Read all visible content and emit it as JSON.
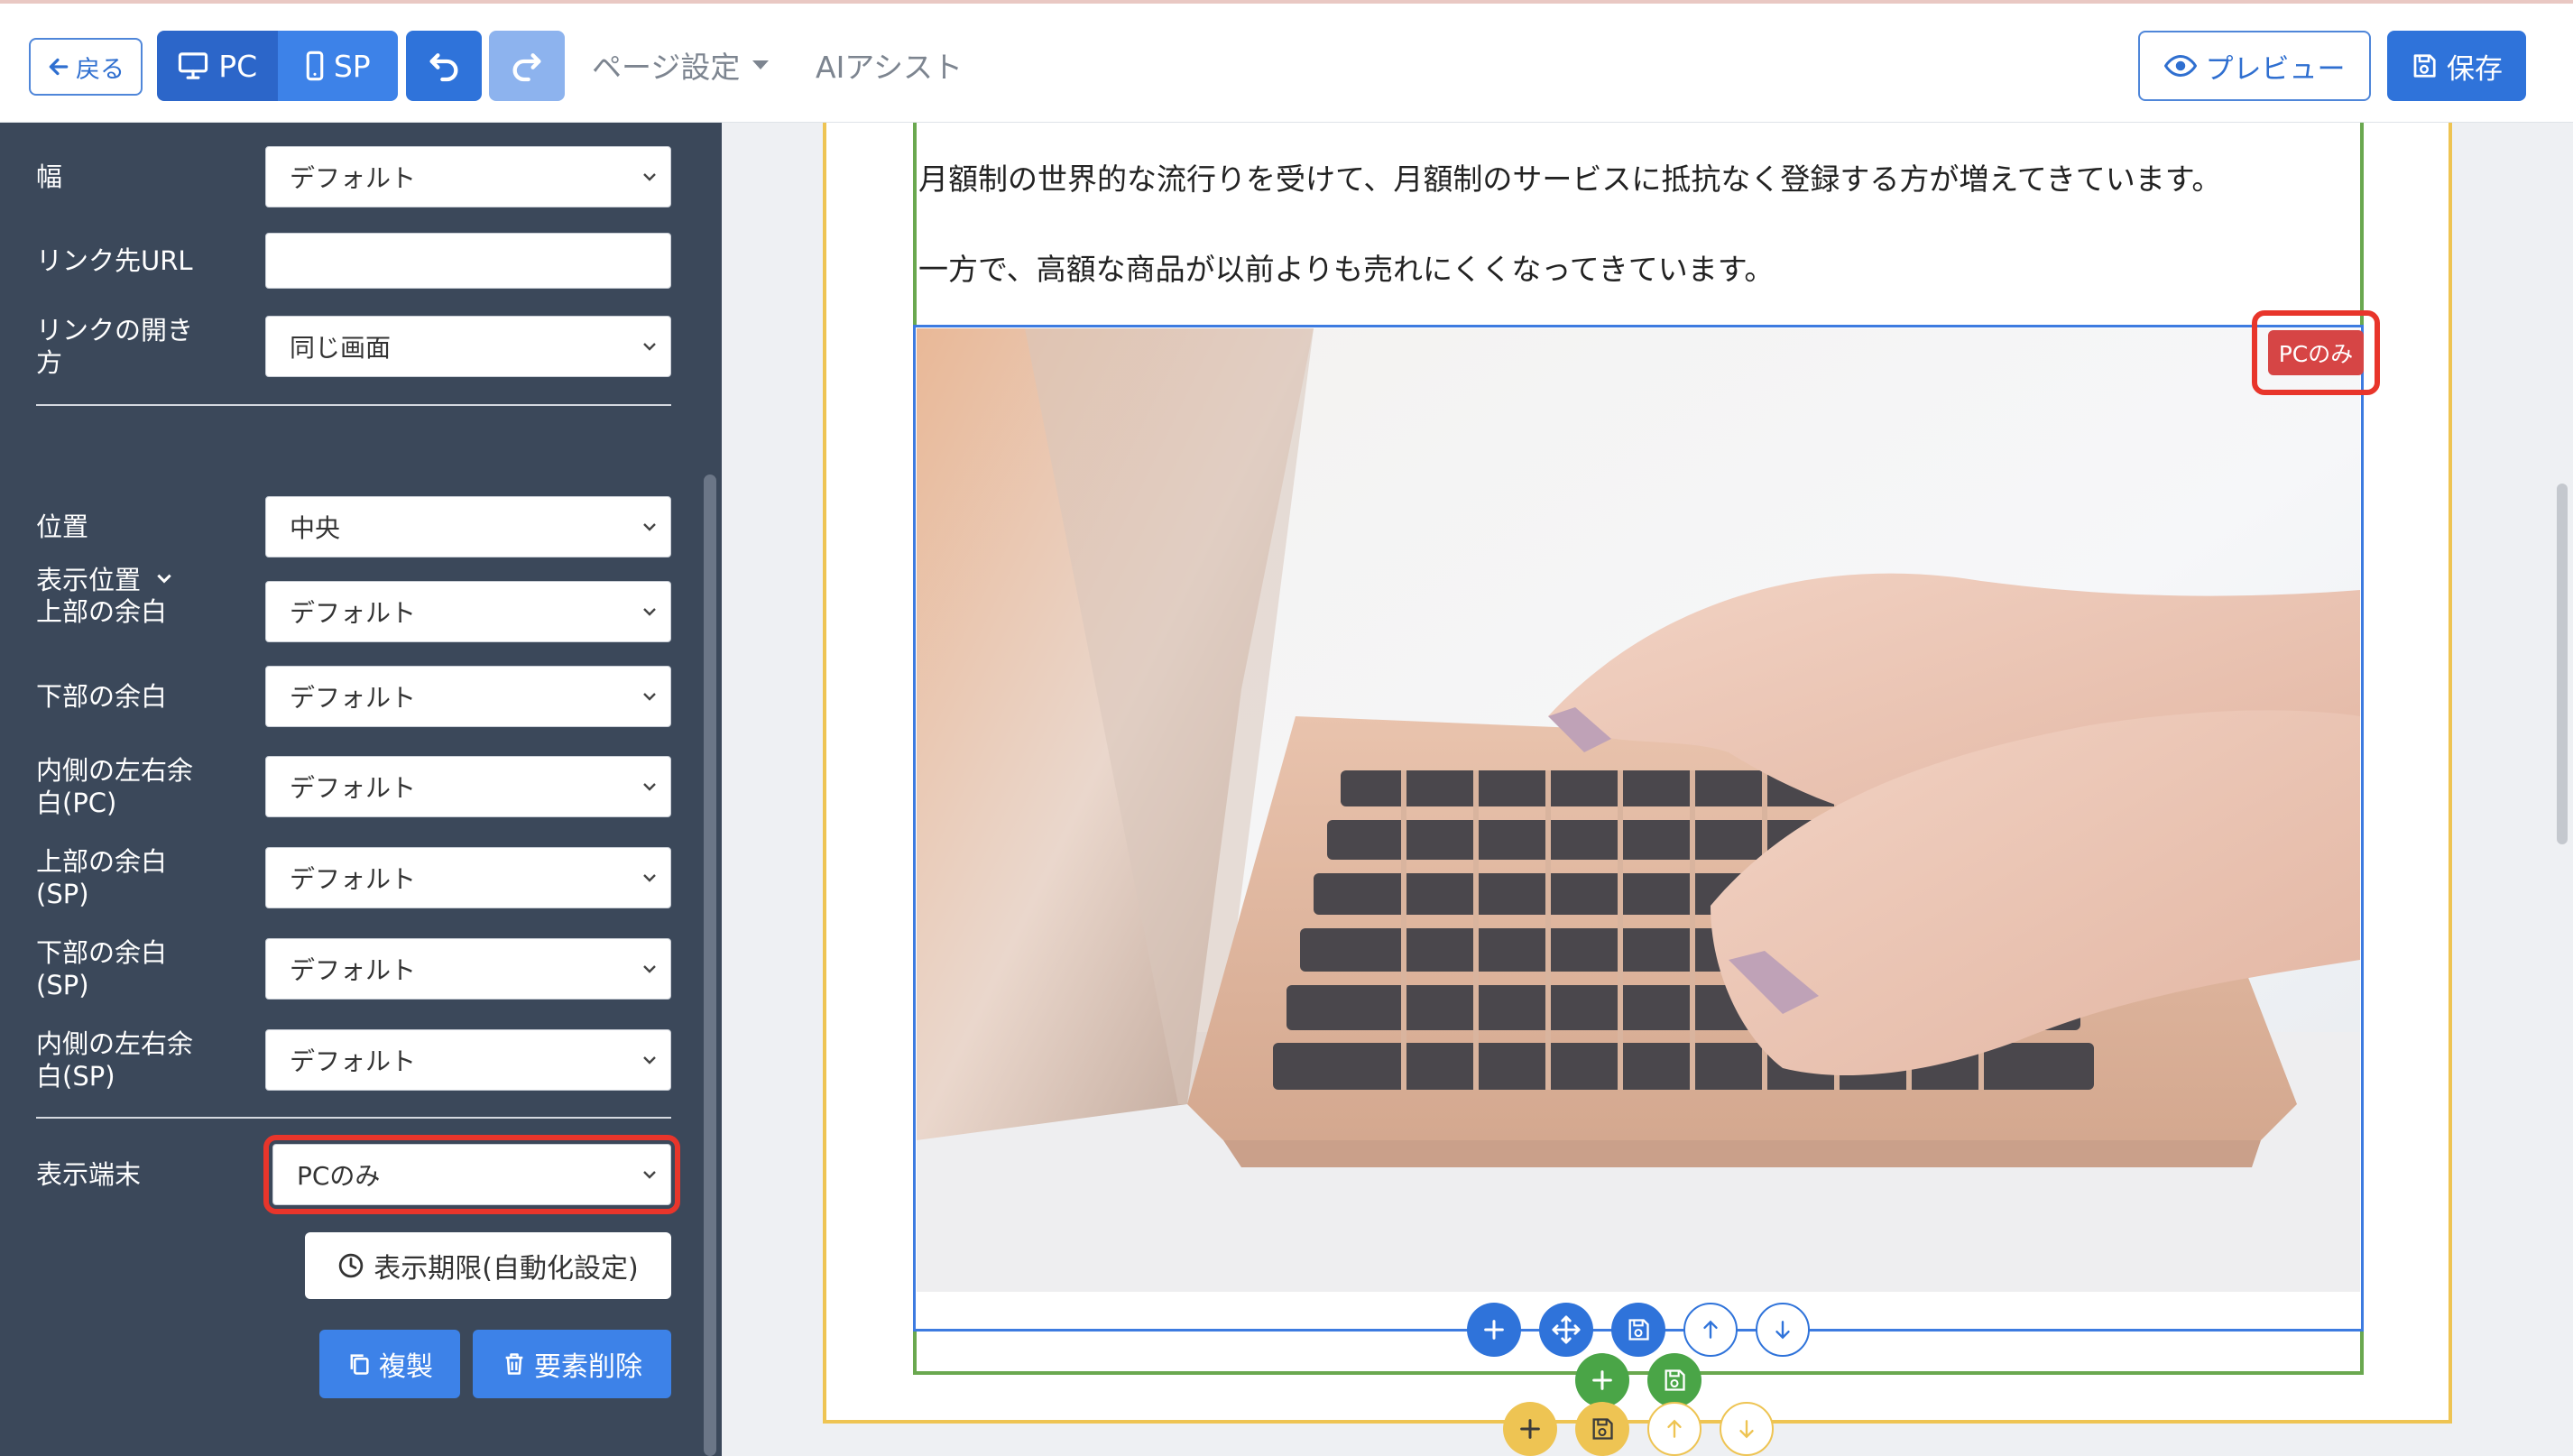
{
  "toolbar": {
    "back_label": "戻る",
    "pc_label": "PC",
    "sp_label": "SP",
    "page_settings_label": "ページ設定",
    "ai_assist_label": "AIアシスト",
    "preview_label": "プレビュー",
    "save_label": "保存"
  },
  "sidebar": {
    "width_label": "幅",
    "width_value": "デフォルト",
    "link_url_label": "リンク先URL",
    "link_url_value": "",
    "link_target_label": "リンクの開き方",
    "link_target_value": "同じ画面",
    "display_position_title": "表示位置",
    "position_label": "位置",
    "position_value": "中央",
    "top_margin_label": "上部の余白",
    "top_margin_value": "デフォルト",
    "bottom_margin_label": "下部の余白",
    "bottom_margin_value": "デフォルト",
    "inner_lr_pc_label": "内側の左右余白(PC)",
    "inner_lr_pc_value": "デフォルト",
    "top_margin_sp_label": "上部の余白(SP)",
    "top_margin_sp_value": "デフォルト",
    "bottom_margin_sp_label": "下部の余白(SP)",
    "bottom_margin_sp_value": "デフォルト",
    "inner_lr_sp_label": "内側の左右余白(SP)",
    "inner_lr_sp_value": "デフォルト",
    "device_label": "表示端末",
    "device_value": "PCのみ",
    "schedule_label": "表示期限(自動化設定)",
    "duplicate_label": "複製",
    "delete_label": "要素削除"
  },
  "canvas": {
    "paragraph1": "月額制の世界的な流行りを受けて、月額制のサービスに抵抗なく登録する方が増えてきています。",
    "paragraph2": "一方で、高額な商品が以前よりも売れにくくなってきています。",
    "pc_only_badge": "PCのみ"
  },
  "colors": {
    "primary": "#2f73da",
    "sidebar_bg": "#3b485a",
    "highlight": "#e8352b",
    "badge": "#d64545",
    "green": "#4aa547",
    "yellow": "#eec453"
  },
  "icons": [
    "arrow-left-icon",
    "monitor-icon",
    "smartphone-icon",
    "undo-icon",
    "redo-icon",
    "caret-down-icon",
    "eye-icon",
    "floppy-icon",
    "chevron-down-icon",
    "clock-icon",
    "copy-icon",
    "trash-icon",
    "plus-icon",
    "move-icon",
    "arrow-up-icon",
    "arrow-down-icon"
  ]
}
